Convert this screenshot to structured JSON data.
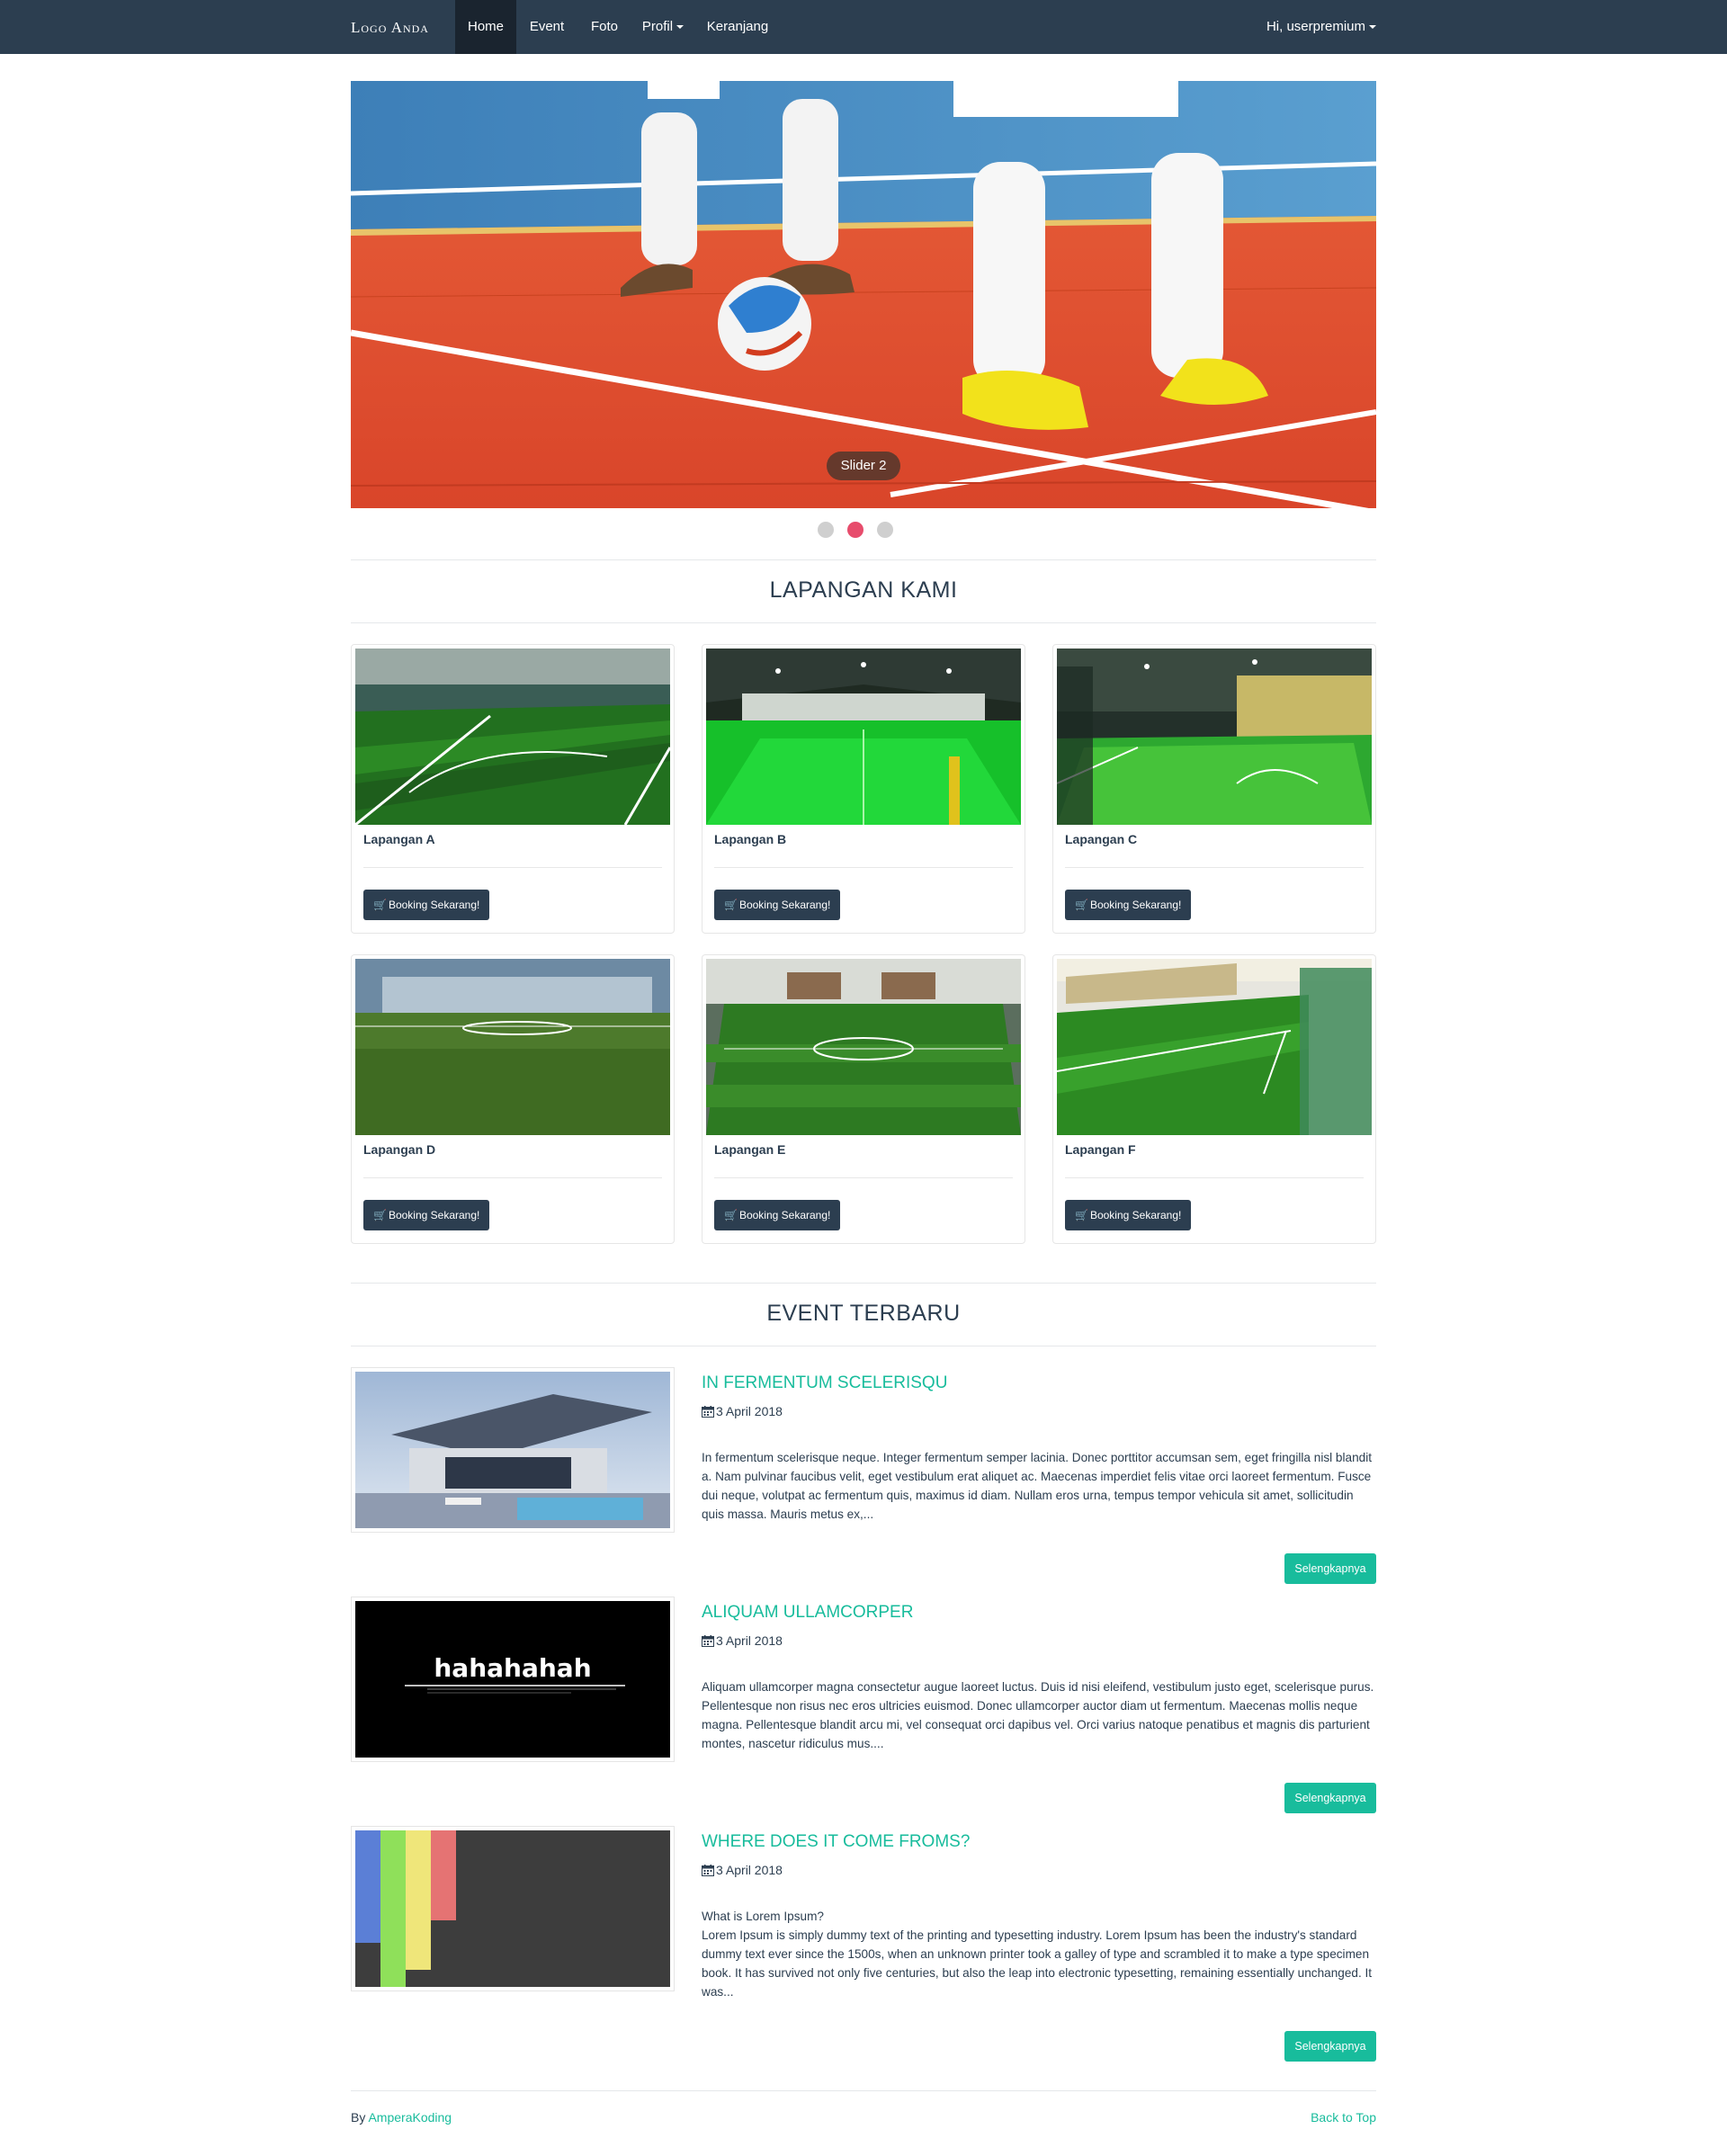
{
  "navbar": {
    "brand": "Logo Anda",
    "items": [
      {
        "label": "Home"
      },
      {
        "label": "Event"
      },
      {
        "label": "Foto"
      },
      {
        "label": "Profil"
      },
      {
        "label": "Keranjang"
      }
    ],
    "user": "Hi, userpremium"
  },
  "slider": {
    "caption": "Slider 2",
    "slide_count": 3,
    "active_index": 2
  },
  "fields": {
    "title": "LAPANGAN KAMI",
    "button_label": "Booking Sekarang!",
    "items": [
      {
        "name": "Lapangan A"
      },
      {
        "name": "Lapangan B"
      },
      {
        "name": "Lapangan C"
      },
      {
        "name": "Lapangan D"
      },
      {
        "name": "Lapangan E"
      },
      {
        "name": "Lapangan F"
      }
    ]
  },
  "events": {
    "title": "EVENT TERBARU",
    "more_label": "Selengkapnya",
    "items": [
      {
        "title": "In fermentum scelerisqu",
        "date": "3 April 2018",
        "text": "In fermentum scelerisque neque. Integer fermentum semper lacinia. Donec porttitor accumsan sem, eget fringilla nisl blandit a. Nam pulvinar faucibus velit, eget vestibulum erat aliquet ac. Maecenas imperdiet felis vitae orci laoreet fermentum. Fusce dui neque, volutpat ac fermentum quis, maximus id diam. Nullam eros urna, tempus tempor vehicula sit amet, sollicitudin quis massa. Mauris metus ex,..."
      },
      {
        "title": "Aliquam ullamcorper",
        "date": "3 April 2018",
        "text": "Aliquam ullamcorper magna consectetur augue laoreet luctus. Duis id nisi eleifend, vestibulum justo eget, scelerisque purus. Pellentesque non risus nec eros ultricies euismod. Donec ullamcorper auctor diam ut fermentum. Maecenas mollis neque magna. Pellentesque blandit arcu mi, vel consequat orci dapibus vel. Orci varius natoque penatibus et magnis dis parturient montes, nascetur ridiculus mus...."
      },
      {
        "title": "Where does it come froms?",
        "date": "3 April 2018",
        "text_heading": "What is Lorem Ipsum?",
        "text": "Lorem Ipsum is simply dummy text of the printing and typesetting industry. Lorem Ipsum has been the industry's standard dummy text ever since the 1500s, when an unknown printer took a galley of type and scrambled it to make a type specimen book. It has survived not only five centuries, but also the leap into electronic typesetting, remaining essentially unchanged. It was..."
      }
    ],
    "image2_text": "hahahahah"
  },
  "footer": {
    "by_prefix": "By ",
    "author": "AmperaKoding",
    "back_to_top": "Back to Top"
  },
  "colors": {
    "navbar": "#2c3e50",
    "accent": "#18bc9c",
    "dot_active": "#e74c6c"
  }
}
